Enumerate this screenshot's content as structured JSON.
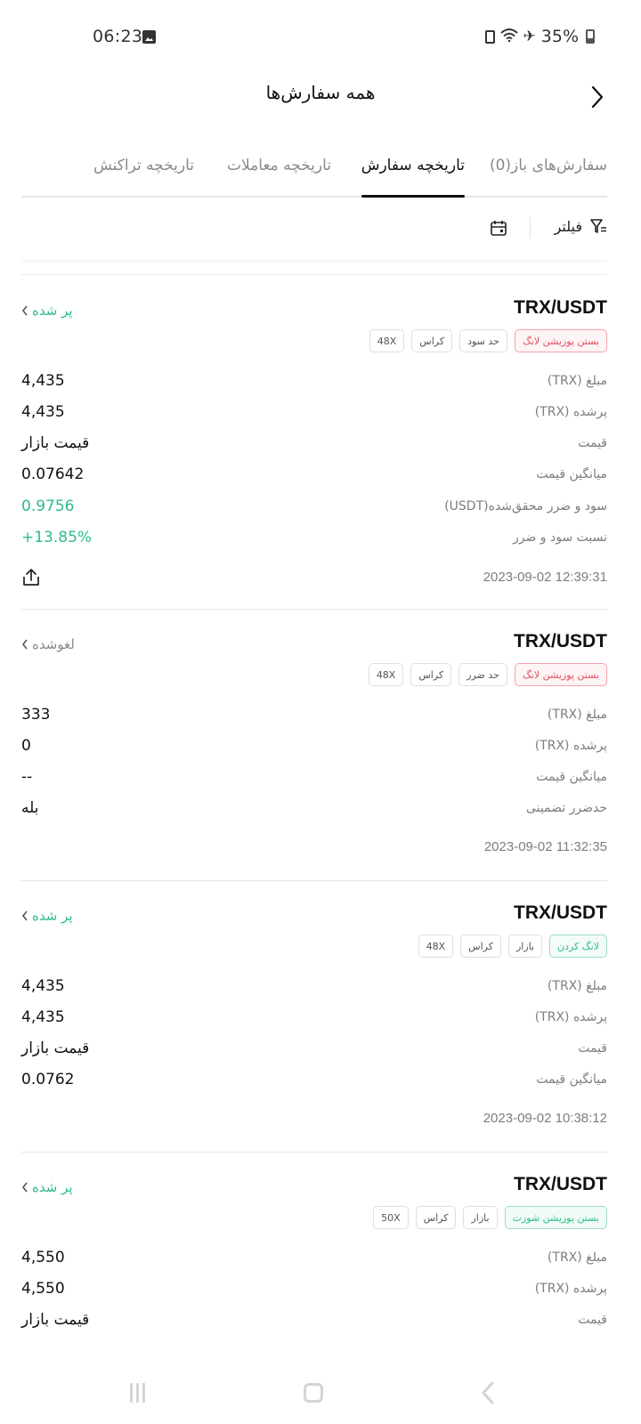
{
  "status_bar": {
    "time": "06:23",
    "battery": "35%"
  },
  "header": {
    "title": "همه سفارش‌ها"
  },
  "tabs": [
    {
      "label": "سفارش‌های باز(0)"
    },
    {
      "label": "تاریخچه سفارش"
    },
    {
      "label": "تاریخچه معاملات"
    },
    {
      "label": "تاریخچه تراکنش"
    }
  ],
  "toolbar": {
    "filter_label": "فیلتر"
  },
  "orders": [
    {
      "pair": "TRX/USDT",
      "status": "پر شده",
      "tags": [
        "بستن پوزیشن لانگ",
        "حد سود",
        "کراس",
        "48X"
      ],
      "rows": [
        {
          "label": "مبلغ (TRX)",
          "value": "4,435"
        },
        {
          "label": "پرشده (TRX)",
          "value": "4,435"
        },
        {
          "label": "قیمت",
          "value": "قیمت بازار"
        },
        {
          "label": "میانگین قیمت",
          "value": "0.07642"
        },
        {
          "label": "سود و ضرر محقق‌شده(USDT)",
          "value": "0.9756"
        },
        {
          "label": "نسبت سود و ضرر",
          "value": "+13.85%"
        }
      ],
      "timestamp": "2023-09-02 12:39:31"
    },
    {
      "pair": "TRX/USDT",
      "status": "لغوشده",
      "tags": [
        "بستن پوزیشن لانگ",
        "حد ضرر",
        "کراس",
        "48X"
      ],
      "rows": [
        {
          "label": "مبلغ (TRX)",
          "value": "333"
        },
        {
          "label": "پرشده (TRX)",
          "value": "0"
        },
        {
          "label": "میانگین قیمت",
          "value": "--"
        },
        {
          "label": "حدضرر تضمینی",
          "value": "بله"
        }
      ],
      "timestamp": "2023-09-02 11:32:35"
    },
    {
      "pair": "TRX/USDT",
      "status": "پر شده",
      "tags": [
        "لانگ کردن",
        "بازار",
        "کراس",
        "48X"
      ],
      "rows": [
        {
          "label": "مبلغ (TRX)",
          "value": "4,435"
        },
        {
          "label": "پرشده (TRX)",
          "value": "4,435"
        },
        {
          "label": "قیمت",
          "value": "قیمت بازار"
        },
        {
          "label": "میانگین قیمت",
          "value": "0.0762"
        }
      ],
      "timestamp": "2023-09-02 10:38:12"
    },
    {
      "pair": "TRX/USDT",
      "status": "پر شده",
      "tags": [
        "بستن پوزیشن شورت",
        "بازار",
        "کراس",
        "50X"
      ],
      "rows": [
        {
          "label": "مبلغ (TRX)",
          "value": "4,550"
        },
        {
          "label": "پرشده (TRX)",
          "value": "4,550"
        },
        {
          "label": "قیمت",
          "value": "قیمت بازار"
        }
      ]
    }
  ],
  "colors": {
    "green": "#2ebd85",
    "red": "#e0505f",
    "text": "#111111",
    "muted": "#7d7d7d"
  }
}
